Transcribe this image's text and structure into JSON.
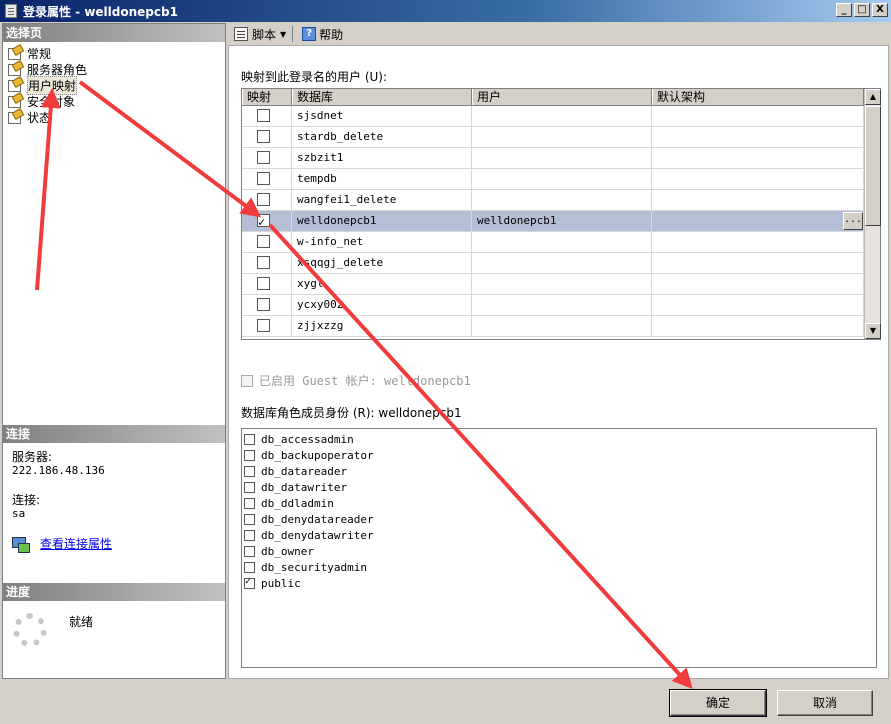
{
  "window": {
    "title": "登录属性 - welldonepcb1",
    "minimize": "_",
    "maximize": "□",
    "close": "X"
  },
  "left": {
    "select_page_header": "选择页",
    "nav_items": [
      "常规",
      "服务器角色",
      "用户映射",
      "安全对象",
      "状态"
    ],
    "selected_index": 2,
    "connection_header": "连接",
    "server_label": "服务器:",
    "server_value": "222.186.48.136",
    "connection_label": "连接:",
    "connection_value": "sa",
    "view_connection_link": "查看连接属性",
    "progress_header": "进度",
    "progress_status": "就绪"
  },
  "toolbar": {
    "script_label": "脚本",
    "help_label": "帮助"
  },
  "mapping": {
    "label": "映射到此登录名的用户 (U):",
    "columns": [
      "映射",
      "数据库",
      "用户",
      "默认架构"
    ],
    "rows": [
      {
        "checked": false,
        "db": "sjsdnet",
        "user": "",
        "schema": ""
      },
      {
        "checked": false,
        "db": "stardb_delete",
        "user": "",
        "schema": ""
      },
      {
        "checked": false,
        "db": "szbzit1",
        "user": "",
        "schema": ""
      },
      {
        "checked": false,
        "db": "tempdb",
        "user": "",
        "schema": ""
      },
      {
        "checked": false,
        "db": "wangfei1_delete",
        "user": "",
        "schema": ""
      },
      {
        "checked": true,
        "db": "welldonepcb1",
        "user": "welldonepcb1",
        "schema": "",
        "selected": true
      },
      {
        "checked": false,
        "db": "w-info_net",
        "user": "",
        "schema": ""
      },
      {
        "checked": false,
        "db": "xsqqgj_delete",
        "user": "",
        "schema": ""
      },
      {
        "checked": false,
        "db": "xygl",
        "user": "",
        "schema": ""
      },
      {
        "checked": false,
        "db": "ycxy002",
        "user": "",
        "schema": ""
      },
      {
        "checked": false,
        "db": "zjjxzzg",
        "user": "",
        "schema": ""
      }
    ],
    "ellipsis": "..."
  },
  "guest": {
    "label": "已启用 Guest 帐户: welldonepcb1"
  },
  "roles": {
    "label": "数据库角色成员身份 (R): welldonepcb1",
    "items": [
      {
        "name": "db_accessadmin",
        "checked": false
      },
      {
        "name": "db_backupoperator",
        "checked": false
      },
      {
        "name": "db_datareader",
        "checked": false
      },
      {
        "name": "db_datawriter",
        "checked": false
      },
      {
        "name": "db_ddladmin",
        "checked": false
      },
      {
        "name": "db_denydatareader",
        "checked": false
      },
      {
        "name": "db_denydatawriter",
        "checked": false
      },
      {
        "name": "db_owner",
        "checked": false
      },
      {
        "name": "db_securityadmin",
        "checked": false
      },
      {
        "name": "public",
        "checked": true
      }
    ]
  },
  "buttons": {
    "ok": "确定",
    "cancel": "取消"
  },
  "colors": {
    "annotation_arrow": "#f03c3c",
    "selection": "#b4bfd6"
  }
}
